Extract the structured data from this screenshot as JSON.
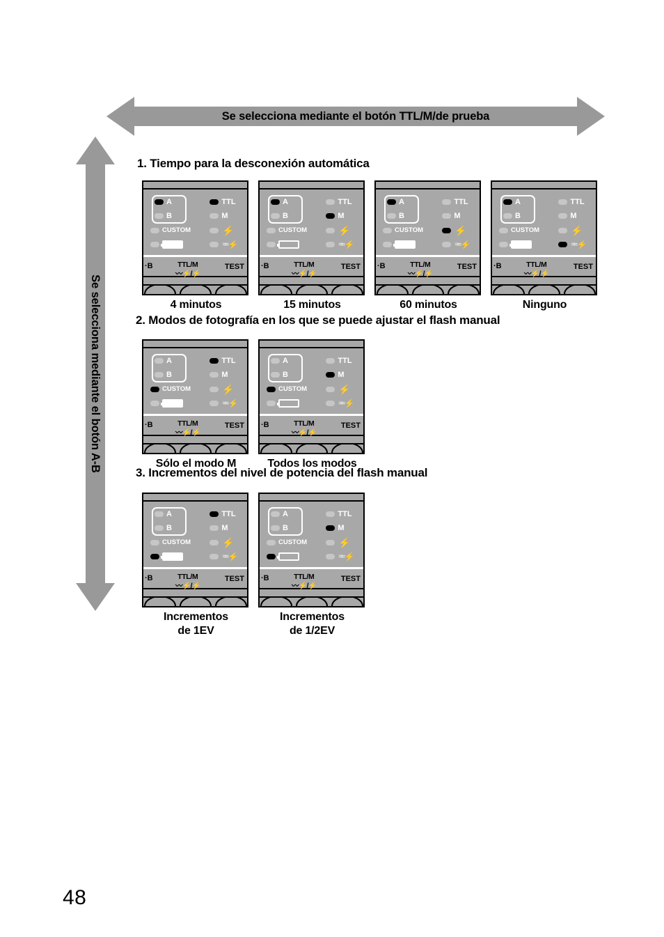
{
  "page": {
    "number": "48",
    "accent_gray": "#999999",
    "lcd_bg": "#a8a8a8",
    "dot_off": "#c6c6c6",
    "dot_on": "#000000"
  },
  "horizontal_arrow": {
    "label": "Se selecciona mediante el botón TTL/M/de prueba",
    "direction": "both"
  },
  "vertical_arrow": {
    "label": "Se selecciona mediante el botón A-B",
    "direction": "both"
  },
  "lcd_legend": {
    "left": "·B",
    "center_line1": "TTL/M",
    "center_line2": "〰⚡/⚡",
    "right": "TEST"
  },
  "indicator_labels": {
    "a": "A",
    "b": "B",
    "custom": "CUSTOM",
    "battery": "battery-icon",
    "ttl": "TTL",
    "m": "M",
    "bolt": "flash-bolt-icon",
    "multi": "multi-flash-icon"
  },
  "sections": [
    {
      "heading": "1. Tiempo para la desconexión automática",
      "panels": [
        {
          "caption": "4 minutos",
          "state": {
            "a": "on",
            "b": "off",
            "custom": "off",
            "batt_dot": "off",
            "batt_fill": "full",
            "ttl": "on",
            "m": "off",
            "bolt": "off",
            "multi": "off"
          }
        },
        {
          "caption": "15 minutos",
          "state": {
            "a": "on",
            "b": "off",
            "custom": "off",
            "batt_dot": "off",
            "batt_fill": "empty",
            "ttl": "off",
            "m": "on",
            "bolt": "off",
            "multi": "off"
          }
        },
        {
          "caption": "60 minutos",
          "state": {
            "a": "on",
            "b": "off",
            "custom": "off",
            "batt_dot": "off",
            "batt_fill": "full",
            "ttl": "off",
            "m": "off",
            "bolt": "on",
            "multi": "off"
          }
        },
        {
          "caption": "Ninguno",
          "state": {
            "a": "on",
            "b": "off",
            "custom": "off",
            "batt_dot": "off",
            "batt_fill": "full",
            "ttl": "off",
            "m": "off",
            "bolt": "off",
            "multi": "on"
          }
        }
      ]
    },
    {
      "heading": "2. Modos de fotografía en los que se puede ajustar el flash manual",
      "panels": [
        {
          "caption": "Sólo el modo M",
          "state": {
            "a": "off",
            "b": "off",
            "custom": "on",
            "batt_dot": "off",
            "batt_fill": "full",
            "ttl": "on",
            "m": "off",
            "bolt": "off",
            "multi": "off"
          }
        },
        {
          "caption": "Todos los modos",
          "state": {
            "a": "off",
            "b": "off",
            "custom": "on",
            "batt_dot": "off",
            "batt_fill": "empty",
            "ttl": "off",
            "m": "on",
            "bolt": "off",
            "multi": "off"
          }
        }
      ]
    },
    {
      "heading": "3. Incrementos del nivel de potencia del flash manual",
      "panels": [
        {
          "caption": "Incrementos\nde 1EV",
          "state": {
            "a": "off",
            "b": "off",
            "custom": "off",
            "batt_dot": "on",
            "batt_fill": "full",
            "ttl": "on",
            "m": "off",
            "bolt": "off",
            "multi": "off"
          }
        },
        {
          "caption": "Incrementos\nde 1/2EV",
          "state": {
            "a": "off",
            "b": "off",
            "custom": "off",
            "batt_dot": "on",
            "batt_fill": "empty",
            "ttl": "off",
            "m": "on",
            "bolt": "off",
            "multi": "off"
          }
        }
      ]
    }
  ]
}
